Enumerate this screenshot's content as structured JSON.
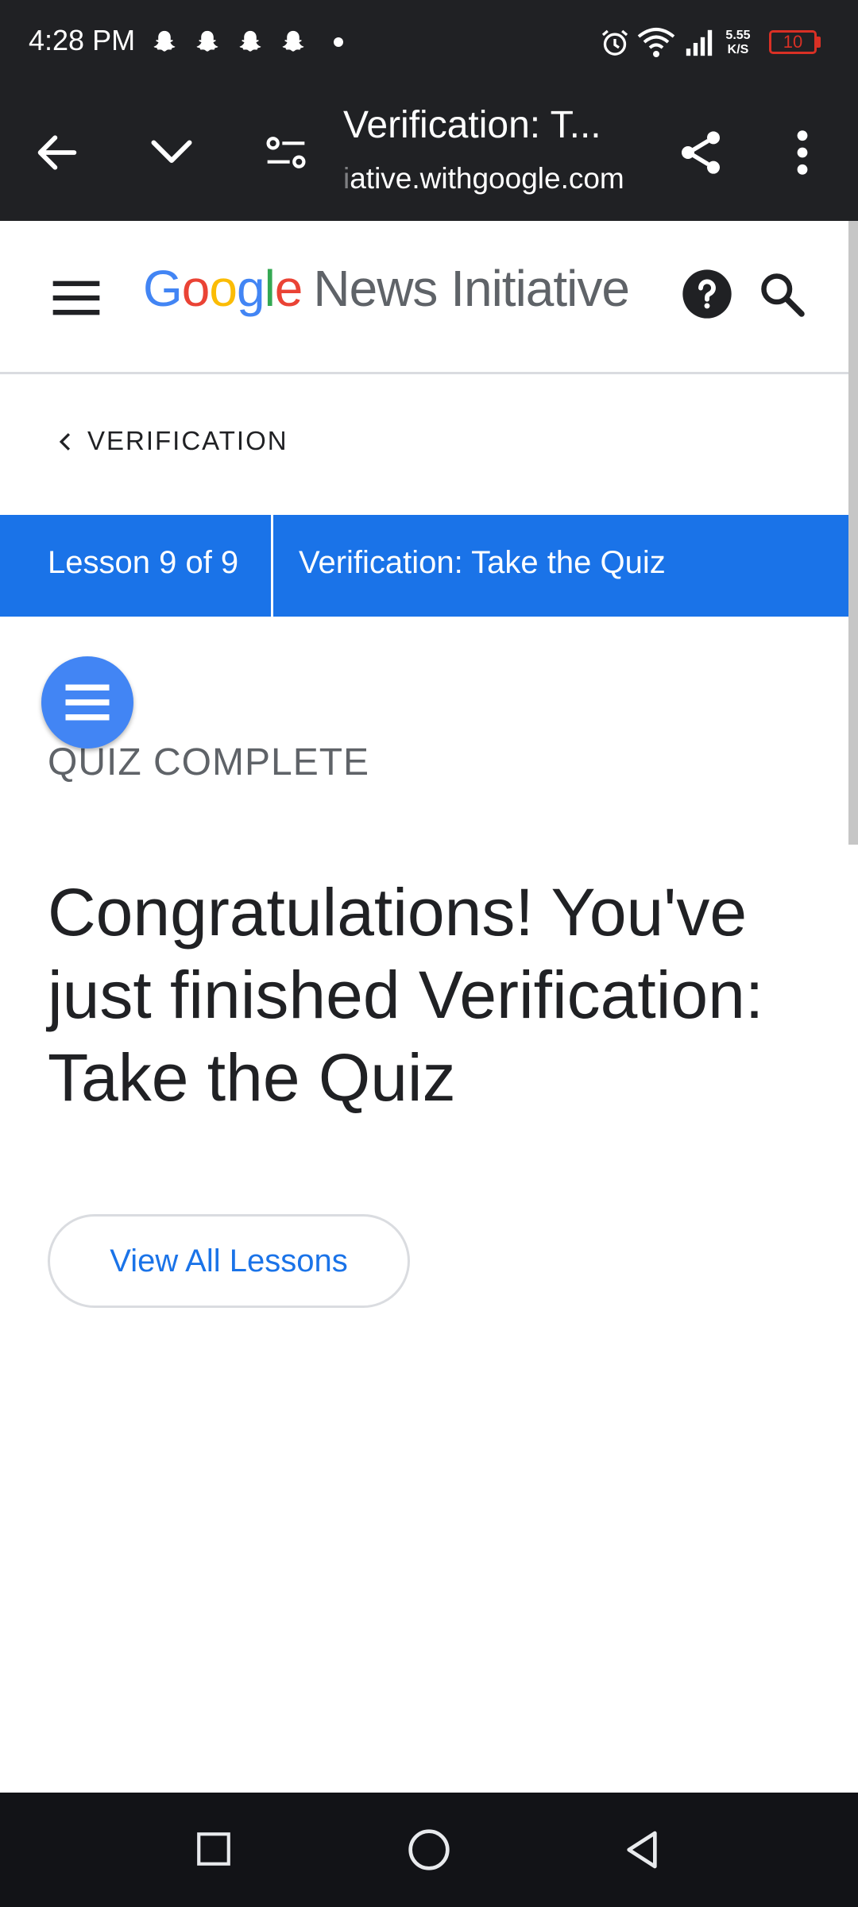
{
  "status_bar": {
    "time": "4:28 PM",
    "net_speed_value": "5.55",
    "net_speed_unit": "K/S",
    "battery": "10"
  },
  "browser": {
    "tab_title": "Verification: T...",
    "url_faded": "i",
    "url": "ative.withgoogle.com"
  },
  "site_header": {
    "logo_g1": "G",
    "logo_o1": "o",
    "logo_o2": "o",
    "logo_g2": "g",
    "logo_l": "l",
    "logo_e": "e",
    "product_name": "News Initiative"
  },
  "breadcrumb": {
    "label": "VERIFICATION"
  },
  "lesson_bar": {
    "count": "Lesson 9 of 9",
    "title": "Verification: Take the Quiz"
  },
  "content": {
    "status": "QUIZ COMPLETE",
    "headline": "Congratulations! You've just finished Verification: Take the Quiz",
    "view_all_button": "View All Lessons"
  },
  "colors": {
    "toolbar_bg": "#202124",
    "accent_blue": "#1a73e8",
    "fab_blue": "#4285f4",
    "battery_red": "#d93025"
  },
  "icons": {
    "status": [
      "snapchat-icon",
      "snapchat-icon",
      "snapchat-icon",
      "snapchat-icon",
      "alarm-icon",
      "wifi-icon",
      "signal-icon",
      "battery-icon"
    ],
    "toolbar": [
      "back-arrow-icon",
      "chevron-down-icon",
      "page-controls-icon",
      "share-icon",
      "more-vert-icon"
    ],
    "header": [
      "menu-icon",
      "help-icon",
      "search-icon"
    ],
    "nav": [
      "recents-square-icon",
      "home-circle-icon",
      "back-triangle-icon"
    ]
  }
}
